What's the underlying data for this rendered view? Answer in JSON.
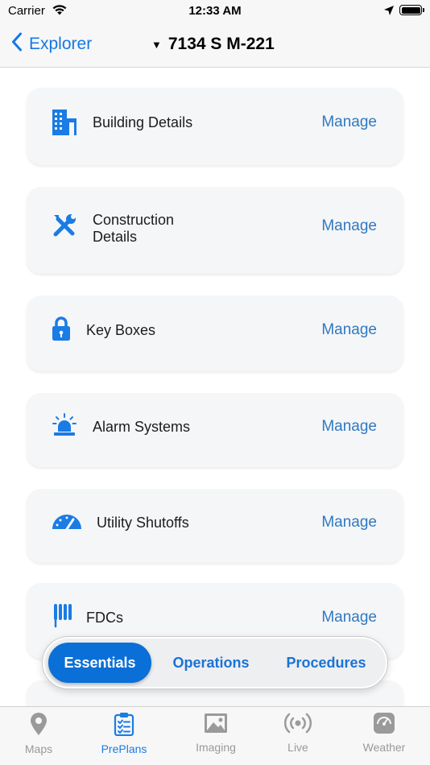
{
  "status_bar": {
    "carrier": "Carrier",
    "time": "12:33 AM"
  },
  "nav": {
    "back_label": "Explorer",
    "title": "7134 S M-221",
    "title_caret": "▼"
  },
  "cards": [
    {
      "label": "Building Details",
      "action": "Manage",
      "icon": "building-icon"
    },
    {
      "label": "Construction Details",
      "label_lines": [
        "Construction",
        "Details"
      ],
      "action": "Manage",
      "icon": "wrench-screwdriver-icon"
    },
    {
      "label": "Key Boxes",
      "action": "Manage",
      "icon": "lock-icon"
    },
    {
      "label": "Alarm Systems",
      "action": "Manage",
      "icon": "alarm-siren-icon"
    },
    {
      "label": "Utility Shutoffs",
      "action": "Manage",
      "icon": "gauge-icon"
    },
    {
      "label": "FDCs",
      "action": "Manage",
      "icon": "fdc-icon"
    }
  ],
  "segments": [
    {
      "label": "Essentials",
      "active": true
    },
    {
      "label": "Operations",
      "active": false
    },
    {
      "label": "Procedures",
      "active": false
    }
  ],
  "tabs": [
    {
      "label": "Maps",
      "icon": "map-pin-icon",
      "active": false
    },
    {
      "label": "PrePlans",
      "icon": "clipboard-checklist-icon",
      "active": true
    },
    {
      "label": "Imaging",
      "icon": "image-icon",
      "active": false
    },
    {
      "label": "Live",
      "icon": "broadcast-icon",
      "active": false
    },
    {
      "label": "Weather",
      "icon": "weather-gauge-icon",
      "active": false
    }
  ],
  "colors": {
    "accent": "#1478e6",
    "manage": "#2f79c0",
    "icon_blue": "#1a7ce4",
    "card_bg": "#f5f6f8",
    "segment_active": "#0a6fd6"
  }
}
